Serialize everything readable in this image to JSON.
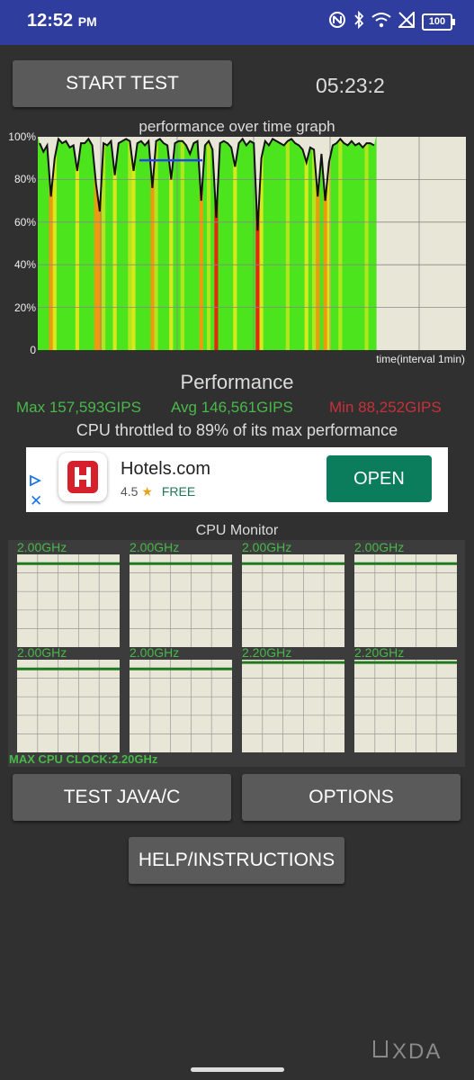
{
  "status": {
    "time": "12:52",
    "ampm": "PM",
    "battery": "100"
  },
  "controls": {
    "start_label": "START TEST",
    "timer": "05:23:2"
  },
  "graph": {
    "title": "performance over time graph",
    "y_ticks": [
      "100%",
      "80%",
      "60%",
      "40%",
      "20%",
      "0"
    ],
    "x_label": "time(interval 1min)"
  },
  "performance": {
    "title": "Performance",
    "max": "Max 157,593GIPS",
    "avg": "Avg 146,561GIPS",
    "min": "Min 88,252GIPS",
    "throttle_text": "CPU throttled to 89% of its max performance"
  },
  "ad": {
    "name": "Hotels.com",
    "rating": "4.5",
    "star": "★",
    "price": "FREE",
    "cta": "OPEN"
  },
  "cpu_monitor": {
    "title": "CPU Monitor",
    "cores": [
      "2.00GHz",
      "2.00GHz",
      "2.00GHz",
      "2.00GHz",
      "2.00GHz",
      "2.00GHz",
      "2.20GHz",
      "2.20GHz"
    ],
    "core_load": [
      0.9,
      0.9,
      0.9,
      0.9,
      0.9,
      0.9,
      0.97,
      0.97
    ],
    "max_clock": "MAX CPU CLOCK:2.20GHz"
  },
  "buttons": {
    "test_java": "TEST JAVA/C",
    "options": "OPTIONS",
    "help": "HELP/INSTRUCTIONS"
  },
  "watermark": "XDA",
  "chart_data": {
    "type": "area",
    "title": "performance over time graph",
    "xlabel": "time(interval 1min)",
    "ylabel": "",
    "ylim": [
      0,
      100
    ],
    "y_ticks": [
      "0",
      "20%",
      "40%",
      "60%",
      "80%",
      "100%"
    ],
    "grid": true,
    "series": [
      {
        "values": [
          97,
          93,
          96,
          72,
          90,
          99,
          97,
          98,
          95,
          96,
          84,
          97,
          97,
          99,
          96,
          78,
          65,
          97,
          96,
          98,
          82,
          97,
          98,
          99,
          98,
          84,
          97,
          98,
          96,
          98,
          76,
          98,
          99,
          97,
          96,
          80,
          97,
          98,
          98,
          96,
          92,
          97,
          98,
          70,
          96,
          98,
          94,
          62,
          97,
          98,
          97,
          95,
          86,
          97,
          99,
          96,
          98,
          97,
          56,
          90,
          98,
          96,
          99,
          98,
          97,
          96,
          98,
          99,
          97,
          96,
          94,
          88,
          95,
          94,
          72,
          92,
          70,
          88,
          96,
          97,
          99,
          97,
          96,
          98,
          96,
          97,
          95,
          97,
          97,
          96
        ]
      }
    ],
    "avg_marker": 89
  }
}
